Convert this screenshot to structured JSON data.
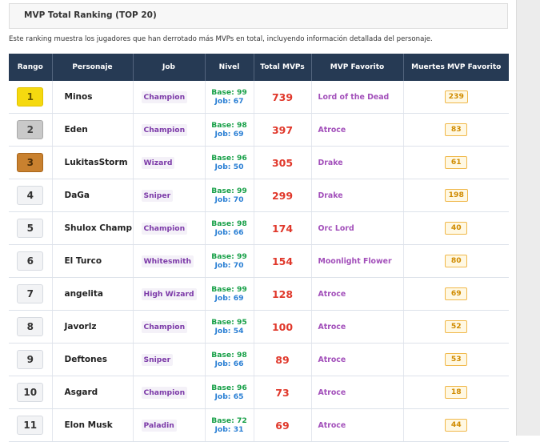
{
  "page": {
    "title": "MVP Total Ranking (TOP 20)",
    "description": "Este ranking muestra los jugadores que han derrotado más MVPs en total, incluyendo información detallada del personaje."
  },
  "table": {
    "headers": [
      "Rango",
      "Personaje",
      "Job",
      "Nivel",
      "Total MVPs",
      "MVP Favorito",
      "Muertes MVP Favorito"
    ],
    "level_prefix_base": "Base: ",
    "level_prefix_job": "Job: ",
    "rows": [
      {
        "rank": "1",
        "badge": "gold",
        "name": "Minos",
        "job": "Champion",
        "base": "99",
        "joblv": "67",
        "total": "739",
        "fav": "Lord of the Dead",
        "deaths": "239"
      },
      {
        "rank": "2",
        "badge": "silver",
        "name": "Eden",
        "job": "Champion",
        "base": "98",
        "joblv": "69",
        "total": "397",
        "fav": "Atroce",
        "deaths": "83"
      },
      {
        "rank": "3",
        "badge": "bronze",
        "name": "LukitasStorm",
        "job": "Wizard",
        "base": "96",
        "joblv": "50",
        "total": "305",
        "fav": "Drake",
        "deaths": "61"
      },
      {
        "rank": "4",
        "badge": "normal",
        "name": "DaGa",
        "job": "Sniper",
        "base": "99",
        "joblv": "70",
        "total": "299",
        "fav": "Drake",
        "deaths": "198"
      },
      {
        "rank": "5",
        "badge": "normal",
        "name": "Shulox Champ",
        "job": "Champion",
        "base": "98",
        "joblv": "66",
        "total": "174",
        "fav": "Orc Lord",
        "deaths": "40"
      },
      {
        "rank": "6",
        "badge": "normal",
        "name": "El Turco",
        "job": "Whitesmith",
        "base": "99",
        "joblv": "70",
        "total": "154",
        "fav": "Moonlight Flower",
        "deaths": "80"
      },
      {
        "rank": "7",
        "badge": "normal",
        "name": "angelita",
        "job": "High Wizard",
        "base": "99",
        "joblv": "69",
        "total": "128",
        "fav": "Atroce",
        "deaths": "69"
      },
      {
        "rank": "8",
        "badge": "normal",
        "name": "Javorlz",
        "job": "Champion",
        "base": "95",
        "joblv": "54",
        "total": "100",
        "fav": "Atroce",
        "deaths": "52"
      },
      {
        "rank": "9",
        "badge": "normal",
        "name": "Deftones",
        "job": "Sniper",
        "base": "98",
        "joblv": "66",
        "total": "89",
        "fav": "Atroce",
        "deaths": "53"
      },
      {
        "rank": "10",
        "badge": "normal",
        "name": "Asgard",
        "job": "Champion",
        "base": "96",
        "joblv": "65",
        "total": "73",
        "fav": "Atroce",
        "deaths": "18"
      },
      {
        "rank": "11",
        "badge": "normal",
        "name": "Elon Musk",
        "job": "Paladin",
        "base": "72",
        "joblv": "31",
        "total": "69",
        "fav": "Atroce",
        "deaths": "44"
      }
    ]
  },
  "colors": {
    "header_bg": "#263a54",
    "gold": "#f5d90f",
    "silver": "#c9c9c9",
    "bronze": "#c9812f",
    "total_mvps": "#e0382b",
    "job_text": "#7c3aa8",
    "favorite_mvp": "#a24fba",
    "base_level": "#18a048",
    "job_level": "#2a7fd4",
    "deaths_badge": "#d08b00"
  }
}
